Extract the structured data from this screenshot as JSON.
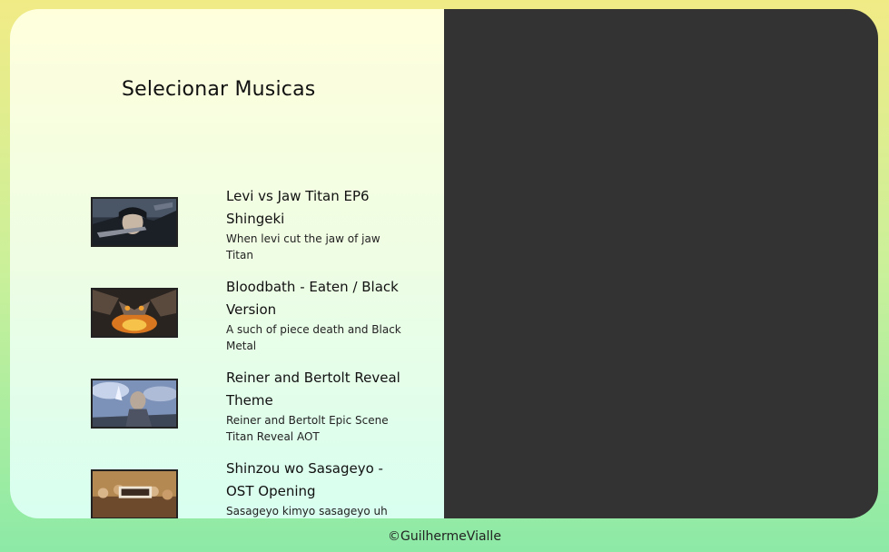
{
  "panel": {
    "title": "Selecionar Musicas"
  },
  "tracks": [
    {
      "title": "Levi vs Jaw Titan EP6 Shingeki",
      "description": "When levi cut the jaw of jaw Titan",
      "thumbnail_icon": "levi-artwork-icon"
    },
    {
      "title": "Bloodbath - Eaten / Black Version",
      "description": "A such of piece death and Black Metal",
      "thumbnail_icon": "bloodbath-artwork-icon"
    },
    {
      "title": "Reiner and Bertolt Reveal Theme",
      "description": "Reiner and Bertolt Epic Scene Titan Reveal AOT",
      "thumbnail_icon": "reiner-artwork-icon"
    },
    {
      "title": "Shinzou wo Sasageyo - OST Opening",
      "description": "Sasageyo kimyo sasageyo uh",
      "thumbnail_icon": "shingeki-artwork-icon"
    }
  ],
  "footer": {
    "text": "©GuilhermeVialle"
  },
  "colors": {
    "player_background": "#333333",
    "thumbnail_border": "#222222"
  }
}
